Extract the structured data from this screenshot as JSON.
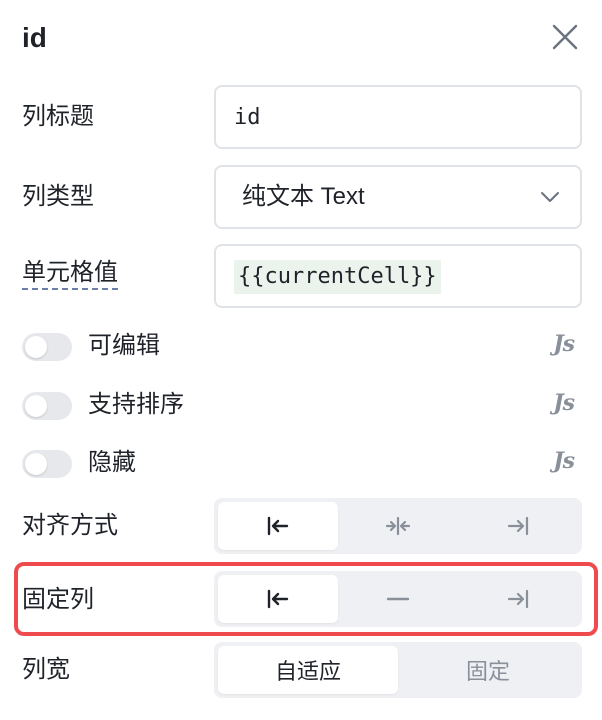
{
  "panel": {
    "title": "id"
  },
  "fields": {
    "column_title": {
      "label": "列标题",
      "value": "id"
    },
    "column_type": {
      "label": "列类型",
      "value": "纯文本 Text"
    },
    "cell_value": {
      "label": "单元格值",
      "value": "{{currentCell}}"
    }
  },
  "toggles": [
    {
      "label": "可编辑",
      "on": false,
      "js": "Js"
    },
    {
      "label": "支持排序",
      "on": false,
      "js": "Js"
    },
    {
      "label": "隐藏",
      "on": false,
      "js": "Js"
    }
  ],
  "alignment": {
    "label": "对齐方式",
    "options": [
      "left",
      "center",
      "right"
    ],
    "selected": "left"
  },
  "fixed_column": {
    "label": "固定列",
    "options": [
      "left",
      "none",
      "right"
    ],
    "selected": "left"
  },
  "column_width": {
    "label": "列宽",
    "options": [
      "自适应",
      "固定"
    ],
    "selected": "自适应"
  },
  "colors": {
    "highlight": "#ef4b4f",
    "code_bg": "#eaf4ec",
    "segment_bg": "#eef0f3"
  }
}
